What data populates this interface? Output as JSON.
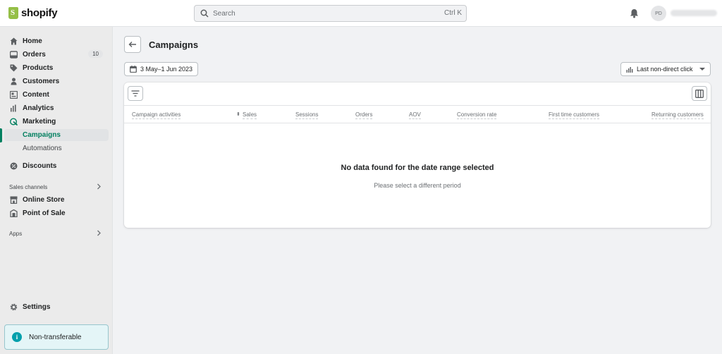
{
  "brand": {
    "name": "shopify",
    "accent": "#008060"
  },
  "search": {
    "placeholder": "Search",
    "shortcut": "Ctrl K"
  },
  "user": {
    "initials": "PD"
  },
  "sidebar": {
    "items": [
      {
        "label": "Home",
        "icon": "home-icon"
      },
      {
        "label": "Orders",
        "icon": "orders-icon",
        "badge": "10"
      },
      {
        "label": "Products",
        "icon": "tag-icon"
      },
      {
        "label": "Customers",
        "icon": "person-icon"
      },
      {
        "label": "Content",
        "icon": "content-icon"
      },
      {
        "label": "Analytics",
        "icon": "bar-chart-icon"
      },
      {
        "label": "Marketing",
        "icon": "marketing-icon"
      },
      {
        "label": "Campaigns",
        "active": true
      },
      {
        "label": "Automations"
      },
      {
        "label": "Discounts",
        "icon": "discount-icon"
      }
    ],
    "sales_channels_label": "Sales channels",
    "channels": [
      {
        "label": "Online Store",
        "icon": "store-icon"
      },
      {
        "label": "Point of Sale",
        "icon": "pos-icon"
      }
    ],
    "apps_label": "Apps",
    "settings_label": "Settings",
    "notice_label": "Non-transferable"
  },
  "page": {
    "title": "Campaigns",
    "date_range": "3 May–1 Jun 2023",
    "attribution_model": "Last non-direct click"
  },
  "table": {
    "columns": [
      "Campaign activities",
      "Sales",
      "Sessions",
      "Orders",
      "AOV",
      "Conversion rate",
      "First time customers",
      "Returning customers"
    ],
    "empty_title": "No data found for the date range selected",
    "empty_subtitle": "Please select a different period"
  }
}
